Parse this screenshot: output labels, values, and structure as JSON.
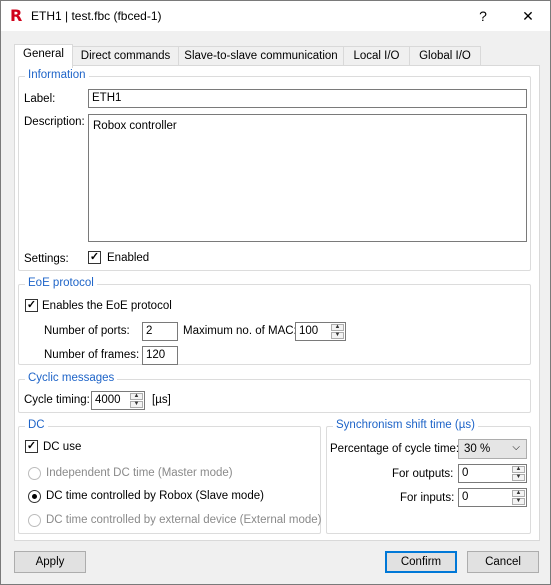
{
  "window": {
    "title": "ETH1 | test.fbc (fbced-1)",
    "logo_letter": "R",
    "help_label": "?",
    "close_label": "✕",
    "brand_color": "#d0021b"
  },
  "tabs": [
    {
      "label": "General",
      "active": true
    },
    {
      "label": "Direct commands"
    },
    {
      "label": "Slave-to-slave communication"
    },
    {
      "label": "Local I/O"
    },
    {
      "label": "Global I/O"
    }
  ],
  "information": {
    "title": "Information",
    "label_caption": "Label:",
    "label_value": "ETH1",
    "description_caption": "Description:",
    "description_value": "Robox controller",
    "settings_caption": "Settings:",
    "enabled_label": "Enabled",
    "enabled_checked": true
  },
  "eoe": {
    "title": "EoE protocol",
    "enable_label": "Enables the EoE protocol",
    "enable_checked": true,
    "ports_caption": "Number of ports:",
    "ports_value": "2",
    "mac_caption": "Maximum no. of MAC:",
    "mac_value": "100",
    "frames_caption": "Number of frames:",
    "frames_value": "120"
  },
  "cyclic": {
    "title": "Cyclic messages",
    "timing_caption": "Cycle timing:",
    "timing_value": "4000",
    "timing_unit": "[µs]"
  },
  "dc": {
    "title": "DC",
    "use_label": "DC use",
    "use_checked": true,
    "options": [
      {
        "label": "Independent DC time (Master mode)",
        "selected": false,
        "disabled": true
      },
      {
        "label": "DC time controlled by Robox (Slave mode)",
        "selected": true,
        "disabled": false
      },
      {
        "label": "DC time controlled by external device (External mode)",
        "selected": false,
        "disabled": true
      }
    ]
  },
  "sync_shift": {
    "title": "Synchronism shift time (µs)",
    "percentage_caption": "Percentage of cycle time:",
    "percentage_value": "30 %",
    "outputs_caption": "For outputs:",
    "outputs_value": "0",
    "inputs_caption": "For inputs:",
    "inputs_value": "0"
  },
  "buttons": {
    "apply": "Apply",
    "confirm": "Confirm",
    "cancel": "Cancel"
  }
}
